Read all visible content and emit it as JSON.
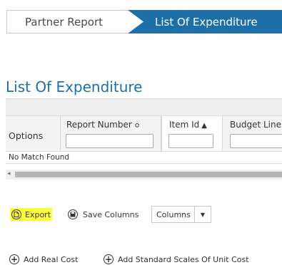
{
  "breadcrumb": {
    "items": [
      {
        "label": "Partner Report",
        "active": false
      },
      {
        "label": "List Of Expenditure",
        "active": true
      }
    ]
  },
  "page": {
    "title": "List Of Expenditure"
  },
  "grid": {
    "columns": [
      {
        "label": "Options",
        "sort": "",
        "filter_value": ""
      },
      {
        "label": "Report Number",
        "sort": "≎",
        "filter_value": ""
      },
      {
        "label": "Item Id",
        "sort": "▲",
        "filter_value": ""
      },
      {
        "label": "Budget Line",
        "sort": "",
        "filter_value": ""
      }
    ],
    "empty_message": "No Match Found"
  },
  "toolbar": {
    "export_label": "Export",
    "save_columns_label": "Save Columns",
    "columns_label": "Columns",
    "export_highlight_color": "#ffff3a"
  },
  "actions": {
    "add_real_cost_label": "Add Real Cost",
    "add_standard_label": "Add Standard Scales Of Unit Cost"
  },
  "colors": {
    "accent": "#1e6fa8"
  }
}
